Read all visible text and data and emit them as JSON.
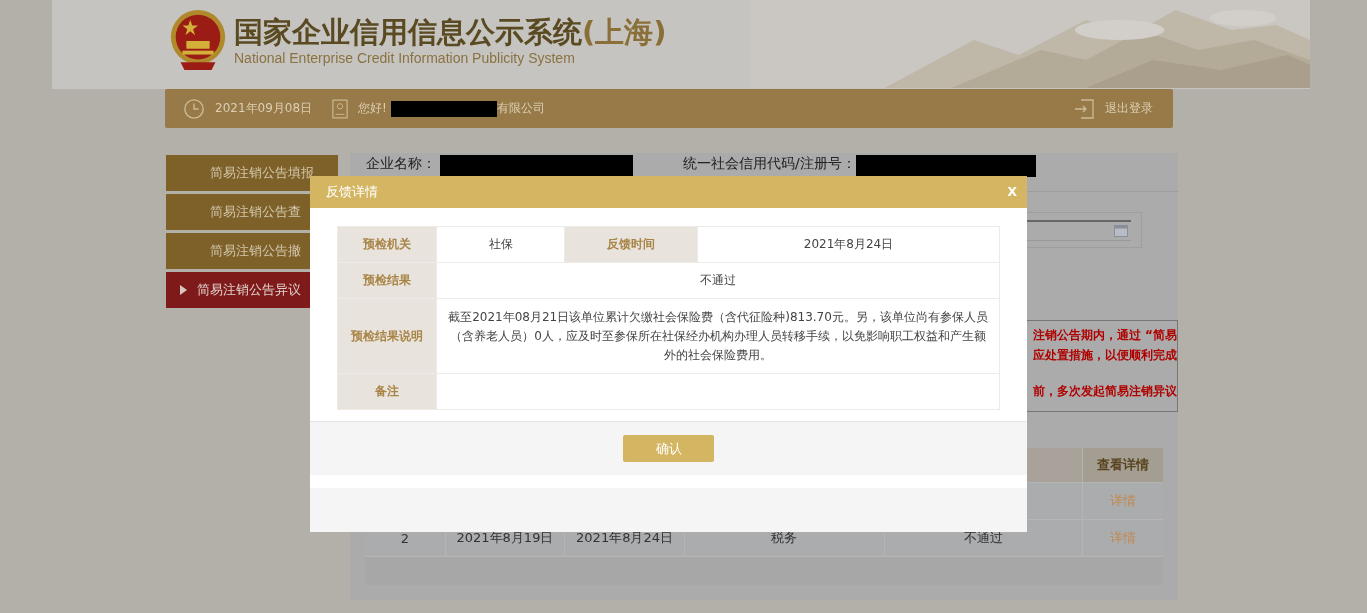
{
  "header": {
    "title": "国家企业信用信息公示系统",
    "region": "(上海)",
    "subtitle": "National Enterprise Credit Information Publicity System"
  },
  "top_bar": {
    "date": "2021年09月08日",
    "greeting": "您好!",
    "company_suffix": "有限公司",
    "logout": "退出登录"
  },
  "sidebar": {
    "items": [
      {
        "label": "简易注销公告填报",
        "selected": false
      },
      {
        "label": "简易注销公告查",
        "selected": false
      },
      {
        "label": "简易注销公告撤",
        "selected": false
      },
      {
        "label": "简易注销公告异议",
        "selected": true
      }
    ]
  },
  "main": {
    "company_label": "企业名称：",
    "code_label": "统一社会信用代码/注册号：",
    "notice_lines": [
      "注销公告期内，通过 “简易",
      "应处置措施，以便顺利完成",
      "前，多次发起简易注销异议"
    ],
    "table": {
      "columns": [
        "查看详情"
      ],
      "rows": [
        {
          "cells": [
            "详情"
          ]
        },
        {
          "cells": [
            "2",
            "2021年8月19日",
            "2021年8月24日",
            "税务",
            "不通过",
            "详情"
          ]
        }
      ]
    }
  },
  "dialog": {
    "title": "反馈详情",
    "close": "x",
    "rows": [
      {
        "fields": [
          {
            "label": "预检机关",
            "value": "社保"
          },
          {
            "label": "反馈时间",
            "value": "2021年8月24日"
          }
        ]
      },
      {
        "fields": [
          {
            "label": "预检结果",
            "value": "不通过"
          }
        ]
      },
      {
        "fields": [
          {
            "label": "预检结果说明",
            "value": "截至2021年08月21日该单位累计欠缴社会保险费（含代征险种)813.70元。另，该单位尚有参保人员（含养老人员）0人，应及时至参保所在社保经办机构办理人员转移手续，以免影响职工权益和产生额外的社会保险费用。"
          }
        ]
      },
      {
        "fields": [
          {
            "label": "备注"
          }
        ]
      }
    ],
    "confirm": "确认"
  }
}
